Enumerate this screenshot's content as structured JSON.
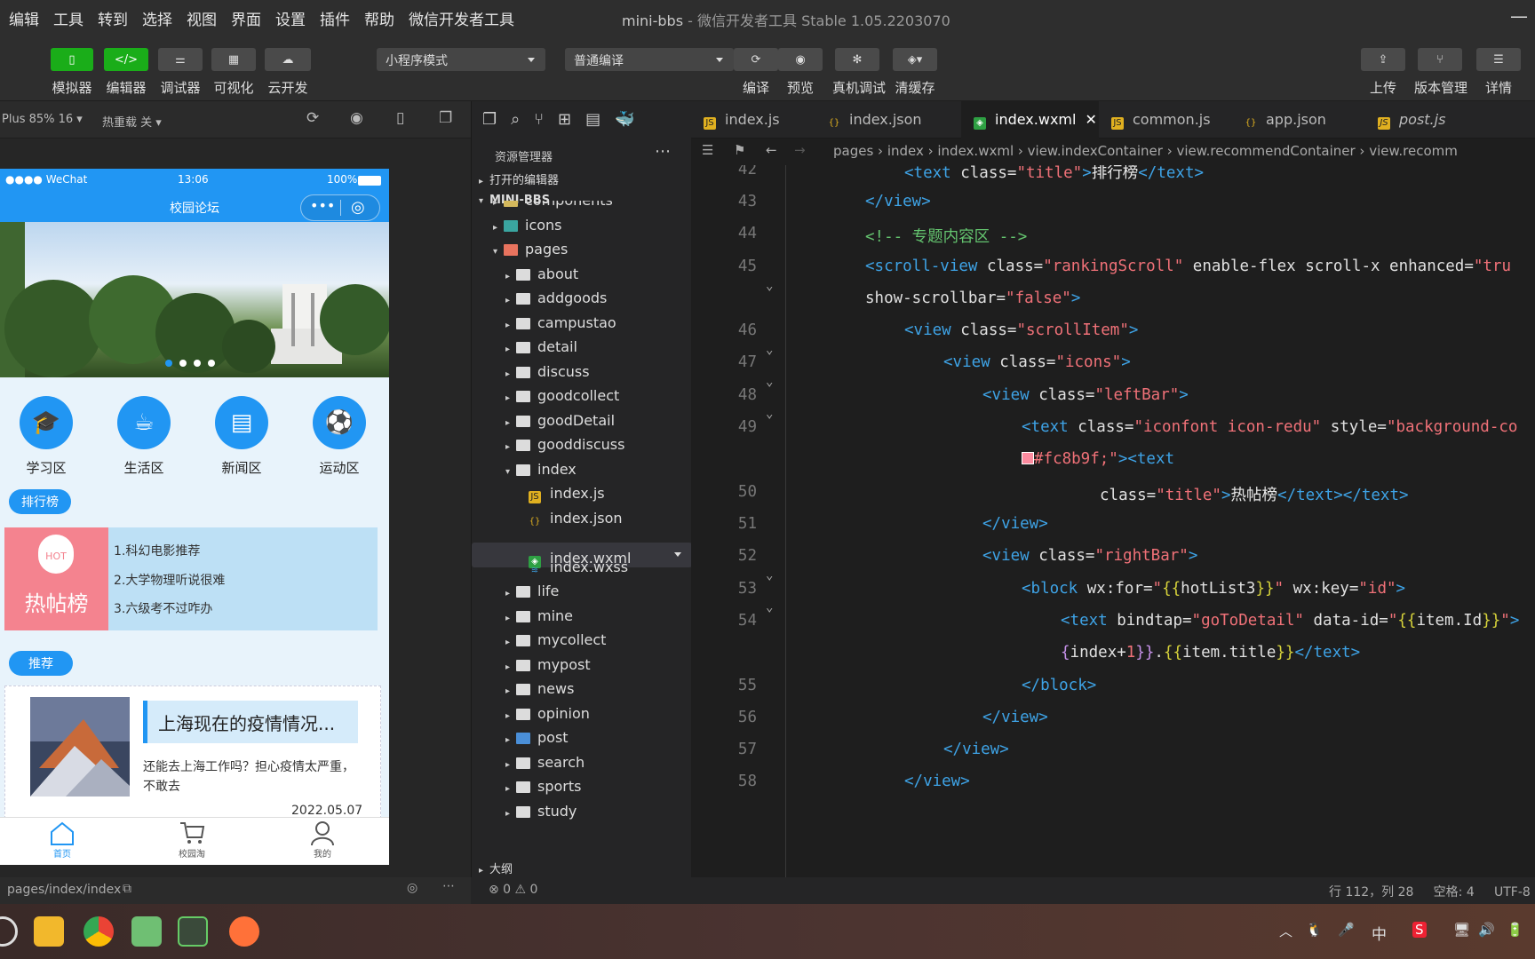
{
  "menu": [
    "编辑",
    "工具",
    "转到",
    "选择",
    "视图",
    "界面",
    "设置",
    "插件",
    "帮助",
    "微信开发者工具"
  ],
  "window": {
    "project": "mini-bbs",
    "title": "- 微信开发者工具 Stable 1.05.2203070",
    "minimize": "—"
  },
  "toolbar": {
    "left_buttons": [
      "模拟器",
      "编辑器",
      "调试器",
      "可视化",
      "云开发"
    ],
    "mode_select": "小程序模式",
    "compile_select": "普通编译",
    "mid_buttons": [
      "编译",
      "预览",
      "真机调试",
      "清缓存"
    ],
    "right_buttons": [
      "上传",
      "版本管理",
      "详情"
    ]
  },
  "simbar": {
    "device": "Plus 85% 16 ▾",
    "hotreload": "热重载 关 ▾"
  },
  "phone": {
    "status_carrier": "●●●● WeChat",
    "status_time": "13:06",
    "status_battery": "100%",
    "nav_title": "校园论坛",
    "categories": [
      "学习区",
      "生活区",
      "新闻区",
      "运动区"
    ],
    "rank_label": "排行榜",
    "hot_title": "热帖榜",
    "hot_badge": "HOT",
    "hot_items": [
      "1.科幻电影推荐",
      "2.大学物理听说很难",
      "3.六级考不过咋办"
    ],
    "recommend_label": "推荐",
    "post_title": "上海现在的疫情情况...",
    "post_summary": "还能去上海工作吗？担心疫情太严重，不敢去",
    "post_date": "2022.05.07",
    "tabs": [
      "首页",
      "校园淘",
      "我的"
    ]
  },
  "sim_footer": {
    "path": "pages/index/index"
  },
  "explorer": {
    "title": "资源管理器",
    "open_editors": "打开的编辑器",
    "project": "MINI-BBS",
    "nodes": [
      {
        "label": "components",
        "indent": 1
      },
      {
        "label": "icons",
        "indent": 1
      },
      {
        "label": "pages",
        "indent": 1
      },
      {
        "label": "about",
        "indent": 2
      },
      {
        "label": "addgoods",
        "indent": 2
      },
      {
        "label": "campustao",
        "indent": 2
      },
      {
        "label": "detail",
        "indent": 2
      },
      {
        "label": "discuss",
        "indent": 2
      },
      {
        "label": "goodcollect",
        "indent": 2
      },
      {
        "label": "goodDetail",
        "indent": 2
      },
      {
        "label": "gooddiscuss",
        "indent": 2
      },
      {
        "label": "index",
        "indent": 2
      },
      {
        "label": "index.js",
        "indent": 3
      },
      {
        "label": "index.json",
        "indent": 3
      },
      {
        "label": "index.wxml",
        "indent": 3
      },
      {
        "label": "index.wxss",
        "indent": 3
      },
      {
        "label": "life",
        "indent": 2
      },
      {
        "label": "mine",
        "indent": 2
      },
      {
        "label": "mycollect",
        "indent": 2
      },
      {
        "label": "mypost",
        "indent": 2
      },
      {
        "label": "news",
        "indent": 2
      },
      {
        "label": "opinion",
        "indent": 2
      },
      {
        "label": "post",
        "indent": 2
      },
      {
        "label": "search",
        "indent": 2
      },
      {
        "label": "sports",
        "indent": 2
      },
      {
        "label": "study",
        "indent": 2
      }
    ],
    "outline": "大纲",
    "problems": "⊗ 0 ⚠ 0"
  },
  "editor": {
    "tabs": [
      "index.js",
      "index.json",
      "index.wxml",
      "common.js",
      "app.json",
      "post.js"
    ],
    "breadcrumb": "pages  ›  index  ›  index.wxml  ›  view.indexContainer  ›  view.recommendContainer  ›  view.recomm",
    "line_numbers": [
      "42",
      "43",
      "44",
      "45",
      "",
      "46",
      "47",
      "48",
      "49",
      "",
      "50",
      "51",
      "52",
      "53",
      "54",
      "",
      "55",
      "56",
      "57",
      "58"
    ],
    "status": "行 112，列 28     空格: 4     UTF-8"
  },
  "colors": {
    "accent": "#2196f3",
    "green": "#1aad19",
    "hot": "#f4838f"
  }
}
